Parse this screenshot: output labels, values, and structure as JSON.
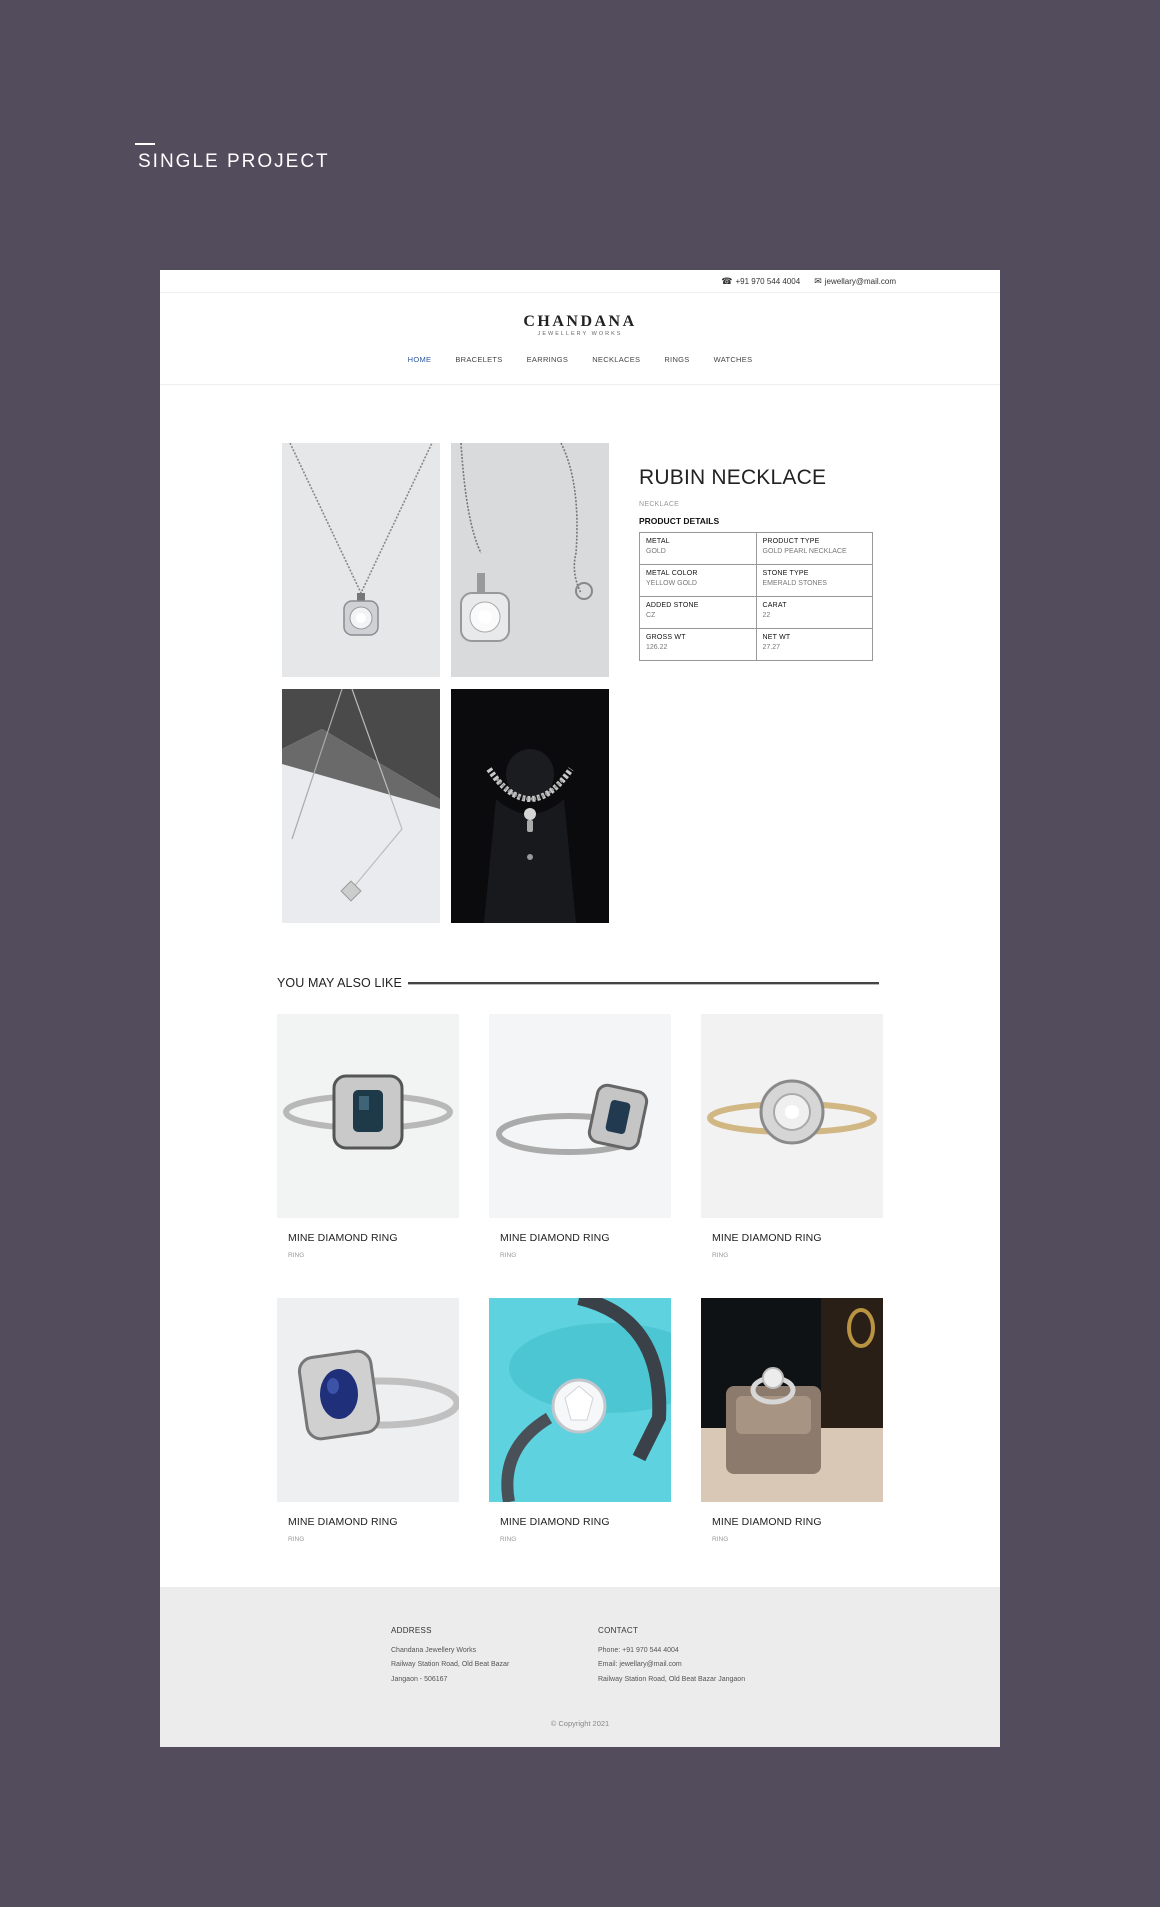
{
  "page": {
    "heading": "SINGLE PROJECT"
  },
  "topbar": {
    "phone": "+91 970 544 4004",
    "email": "jewellary@mail.com",
    "phone_icon": "phone-icon",
    "email_icon": "envelope-icon"
  },
  "brand": {
    "name": "CHANDANA",
    "tagline": "JEWELLERY WORKS"
  },
  "nav": [
    {
      "label": "HOME",
      "active": true
    },
    {
      "label": "BRACELETS"
    },
    {
      "label": "EARRINGS"
    },
    {
      "label": "NECKLACES"
    },
    {
      "label": "RINGS"
    },
    {
      "label": "WATCHES"
    }
  ],
  "product": {
    "title": "RUBIN NECKLACE",
    "category": "NECKLACE",
    "details_heading": "PRODUCT DETAILS",
    "specs": [
      [
        {
          "label": "METAL",
          "value": "GOLD"
        },
        {
          "label": "PRODUCT TYPE",
          "value": "GOLD PEARL NECKLACE"
        }
      ],
      [
        {
          "label": "METAL COLOR",
          "value": "YELLOW GOLD"
        },
        {
          "label": "STONE TYPE",
          "value": "EMERALD STONES"
        }
      ],
      [
        {
          "label": "ADDED STONE",
          "value": "CZ"
        },
        {
          "label": "CARAT",
          "value": "22"
        }
      ],
      [
        {
          "label": "GROSS WT",
          "value": "126.22"
        },
        {
          "label": "NET WT",
          "value": "27.27"
        }
      ]
    ]
  },
  "related": {
    "title": "YOU MAY ALSO LIKE",
    "items": [
      {
        "name": "MINE DIAMOND RING",
        "category": "RING"
      },
      {
        "name": "MINE DIAMOND RING",
        "category": "RING"
      },
      {
        "name": "MINE DIAMOND RING",
        "category": "RING"
      },
      {
        "name": "MINE DIAMOND RING",
        "category": "RING"
      },
      {
        "name": "MINE DIAMOND RING",
        "category": "RING"
      },
      {
        "name": "MINE DIAMOND RING",
        "category": "RING"
      }
    ]
  },
  "footer": {
    "address": {
      "heading": "ADDRESS",
      "line1": "Chandana Jewellery Works",
      "line2": "Railway Station Road, Old Beat Bazar",
      "line3": "Jangaon - 506167"
    },
    "contact": {
      "heading": "CONTACT",
      "phone": "Phone: +91 970 544 4004",
      "email": "Email: jewellary@mail.com",
      "address": "Railway Station Road, Old Beat Bazar Jangaon"
    },
    "copyright": "© Copyright 2021"
  },
  "colors": {
    "page_bg": "#524c5c",
    "accent": "#2c5aa0",
    "footer_bg": "#ececec"
  }
}
